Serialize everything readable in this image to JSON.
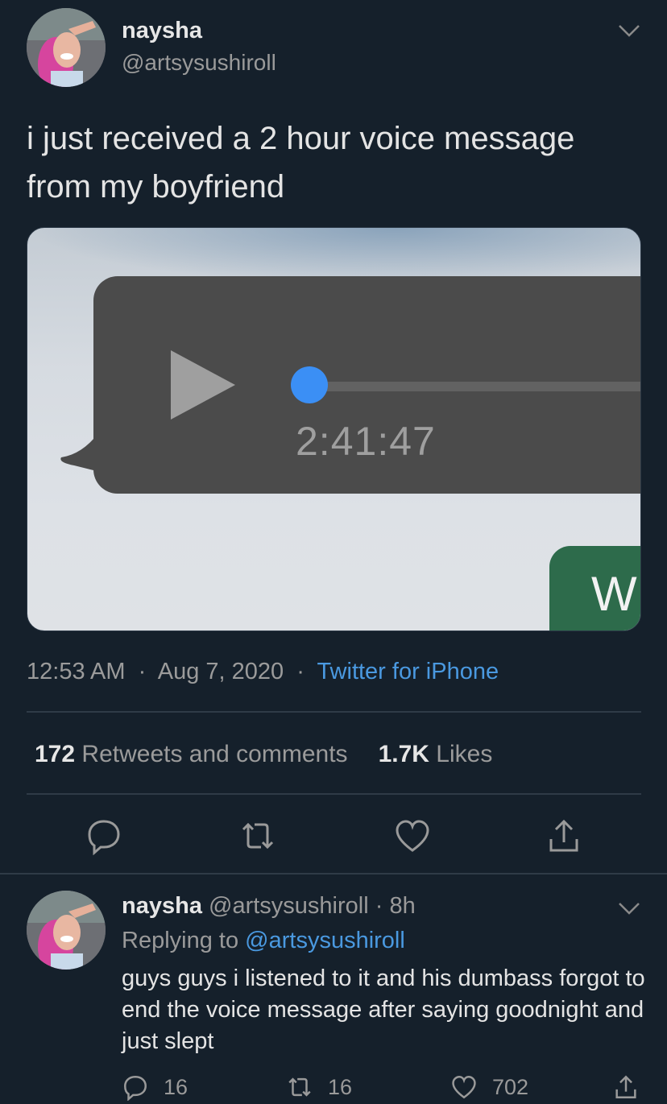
{
  "tweet": {
    "author_name": "naysha",
    "author_handle": "@artsysushiroll",
    "text": "i just received a 2 hour voice message from my boyfriend",
    "media": {
      "voice_duration": "2:41:47",
      "partial_letter": "W"
    },
    "time": "12:53 AM",
    "date": "Aug 7, 2020",
    "source": "Twitter for iPhone",
    "separator": "·",
    "retweets_count": "172",
    "retweets_label": "Retweets and comments",
    "likes_count": "1.7K",
    "likes_label": "Likes"
  },
  "reply": {
    "author_name": "naysha",
    "author_handle": "@artsysushiroll",
    "age": "8h",
    "replying_label": "Replying to",
    "replying_to": "@artsysushiroll",
    "text": "guys guys i listened to it and his dumbass forgot to end the voice message after saying goodnight and just slept",
    "replies": "16",
    "retweets": "16",
    "likes": "702"
  },
  "icons": [
    "chevron-down-icon",
    "reply-icon",
    "retweet-icon",
    "like-icon",
    "share-icon",
    "play-icon"
  ],
  "colors": {
    "background": "#15202b",
    "link": "#4a99e0",
    "progress_dot": "#3b8ff5"
  }
}
